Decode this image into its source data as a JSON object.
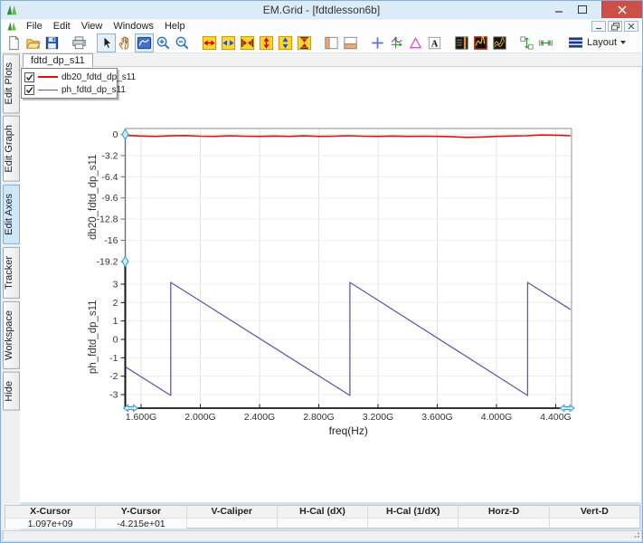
{
  "window": {
    "title": "EM.Grid - [fdtdlesson6b]",
    "titlebar_buttons": [
      "minimize",
      "maximize",
      "close"
    ],
    "mdi_buttons": [
      "mdi-minimize",
      "mdi-restore",
      "mdi-close"
    ]
  },
  "menubar": {
    "items": [
      "File",
      "Edit",
      "View",
      "Windows",
      "Help"
    ]
  },
  "toolbar": {
    "layout_label": "Layout",
    "buttons": [
      {
        "name": "new-file",
        "group": 0
      },
      {
        "name": "open-file",
        "group": 0
      },
      {
        "name": "save-file",
        "group": 0
      },
      {
        "name": "print",
        "group": 1
      },
      {
        "name": "select-cursor",
        "group": 2,
        "selected": true
      },
      {
        "name": "pan-hand",
        "group": 2
      },
      {
        "name": "plot-mode",
        "group": 2,
        "selected": true
      },
      {
        "name": "zoom-in",
        "group": 2
      },
      {
        "name": "zoom-out",
        "group": 2
      },
      {
        "name": "expand-x-red",
        "group": 3
      },
      {
        "name": "expand-x-blue",
        "group": 3
      },
      {
        "name": "fit-x",
        "group": 3
      },
      {
        "name": "expand-y-red",
        "group": 3
      },
      {
        "name": "expand-y-blue",
        "group": 3
      },
      {
        "name": "fit-y",
        "group": 3
      },
      {
        "name": "panel-left",
        "group": 4
      },
      {
        "name": "panel-bottom",
        "group": 4
      },
      {
        "name": "add-cursor",
        "group": 5
      },
      {
        "name": "axes-tracker",
        "group": 5
      },
      {
        "name": "delta-marker",
        "group": 5
      },
      {
        "name": "text-annotation",
        "group": 5
      },
      {
        "name": "plot-thumb-bar",
        "group": 6
      },
      {
        "name": "plot-thumb-red",
        "group": 6
      },
      {
        "name": "plot-thumb-waves",
        "group": 6
      },
      {
        "name": "space-vertical",
        "group": 7
      },
      {
        "name": "space-horizontal",
        "group": 7
      }
    ]
  },
  "document_tabs": {
    "active": "fdtd_dp_s11"
  },
  "sidebar": {
    "tabs": [
      {
        "label": "Edit Plots",
        "active": false
      },
      {
        "label": "Edit Graph",
        "active": false
      },
      {
        "label": "Edit Axes",
        "active": true
      },
      {
        "label": "Tracker",
        "active": false
      },
      {
        "label": "Workspace",
        "active": false
      },
      {
        "label": "Hide",
        "active": false
      }
    ]
  },
  "legend": {
    "entries": [
      {
        "checked": true,
        "color": "#dd1111",
        "thickness": 2,
        "label": "db20_fdtd_dp_s11"
      },
      {
        "checked": true,
        "color": "#5c5cac",
        "thickness": 1.4,
        "label": "ph_fdtd_dp_s11"
      }
    ]
  },
  "chart_data": {
    "type": "line",
    "grid": true,
    "legend_position": "top-left",
    "x": {
      "label": "freq(Hz)",
      "unit": "GHz",
      "min": 1.5,
      "max": 4.5,
      "tick_labels": [
        "1.600G",
        "2.000G",
        "2.400G",
        "2.800G",
        "3.200G",
        "3.600G",
        "4.000G",
        "4.400G"
      ],
      "tick_values": [
        1.6,
        2.0,
        2.4,
        2.8,
        3.2,
        3.6,
        4.0,
        4.4
      ]
    },
    "plots": [
      {
        "ylabel": "db20_fdtd_dp_s11",
        "ytick_labels": [
          "0",
          "-3.2",
          "-6.4",
          "-9.6",
          "-12.8",
          "-16",
          "-19.2"
        ],
        "ytick_values": [
          0,
          -3.2,
          -6.4,
          -9.6,
          -12.8,
          -16,
          -19.2
        ],
        "ylim": [
          0.9,
          -20.6
        ],
        "series": [
          {
            "name": "db20_fdtd_dp_s11",
            "color": "#dd1111",
            "width": 1.6,
            "points": [
              [
                1.5,
                -0.15
              ],
              [
                1.6,
                -0.25
              ],
              [
                1.7,
                -0.3
              ],
              [
                1.8,
                -0.22
              ],
              [
                1.9,
                -0.18
              ],
              [
                2.0,
                -0.28
              ],
              [
                2.1,
                -0.3
              ],
              [
                2.2,
                -0.22
              ],
              [
                2.3,
                -0.28
              ],
              [
                2.4,
                -0.3
              ],
              [
                2.5,
                -0.25
              ],
              [
                2.6,
                -0.3
              ],
              [
                2.7,
                -0.22
              ],
              [
                2.8,
                -0.3
              ],
              [
                2.9,
                -0.28
              ],
              [
                3.0,
                -0.2
              ],
              [
                3.1,
                -0.28
              ],
              [
                3.2,
                -0.3
              ],
              [
                3.3,
                -0.25
              ],
              [
                3.4,
                -0.3
              ],
              [
                3.5,
                -0.28
              ],
              [
                3.6,
                -0.3
              ],
              [
                3.7,
                -0.35
              ],
              [
                3.8,
                -0.45
              ],
              [
                3.9,
                -0.4
              ],
              [
                4.0,
                -0.3
              ],
              [
                4.1,
                -0.25
              ],
              [
                4.2,
                -0.2
              ],
              [
                4.3,
                -0.1
              ],
              [
                4.4,
                -0.12
              ],
              [
                4.5,
                -0.2
              ]
            ]
          }
        ]
      },
      {
        "ylabel": "ph_fdtd_dp_s11",
        "ytick_labels": [
          "3",
          "2",
          "1",
          "0",
          "-1",
          "-2",
          "-3"
        ],
        "ytick_values": [
          3,
          2,
          1,
          0,
          -1,
          -2,
          -3
        ],
        "ylim": [
          3.9,
          -3.8
        ],
        "series": [
          {
            "name": "ph_fdtd_dp_s11",
            "color": "#5c5cac",
            "width": 1.3,
            "points": [
              [
                1.5,
                -1.52
              ],
              [
                1.8,
                -3.05
              ],
              [
                1.8,
                3.1
              ],
              [
                3.01,
                -3.05
              ],
              [
                3.01,
                3.1
              ],
              [
                4.21,
                -3.05
              ],
              [
                4.21,
                3.1
              ],
              [
                4.5,
                1.62
              ]
            ]
          }
        ]
      }
    ]
  },
  "status_table": {
    "columns": [
      {
        "label": "X-Cursor",
        "value": "1.097e+09"
      },
      {
        "label": "Y-Cursor",
        "value": "-4.215e+01"
      },
      {
        "label": "V-Caliper",
        "value": ""
      },
      {
        "label": "H-Cal (dX)",
        "value": ""
      },
      {
        "label": "H-Cal (1/dX)",
        "value": ""
      },
      {
        "label": "Horz-D",
        "value": ""
      },
      {
        "label": "Vert-D",
        "value": ""
      }
    ]
  }
}
